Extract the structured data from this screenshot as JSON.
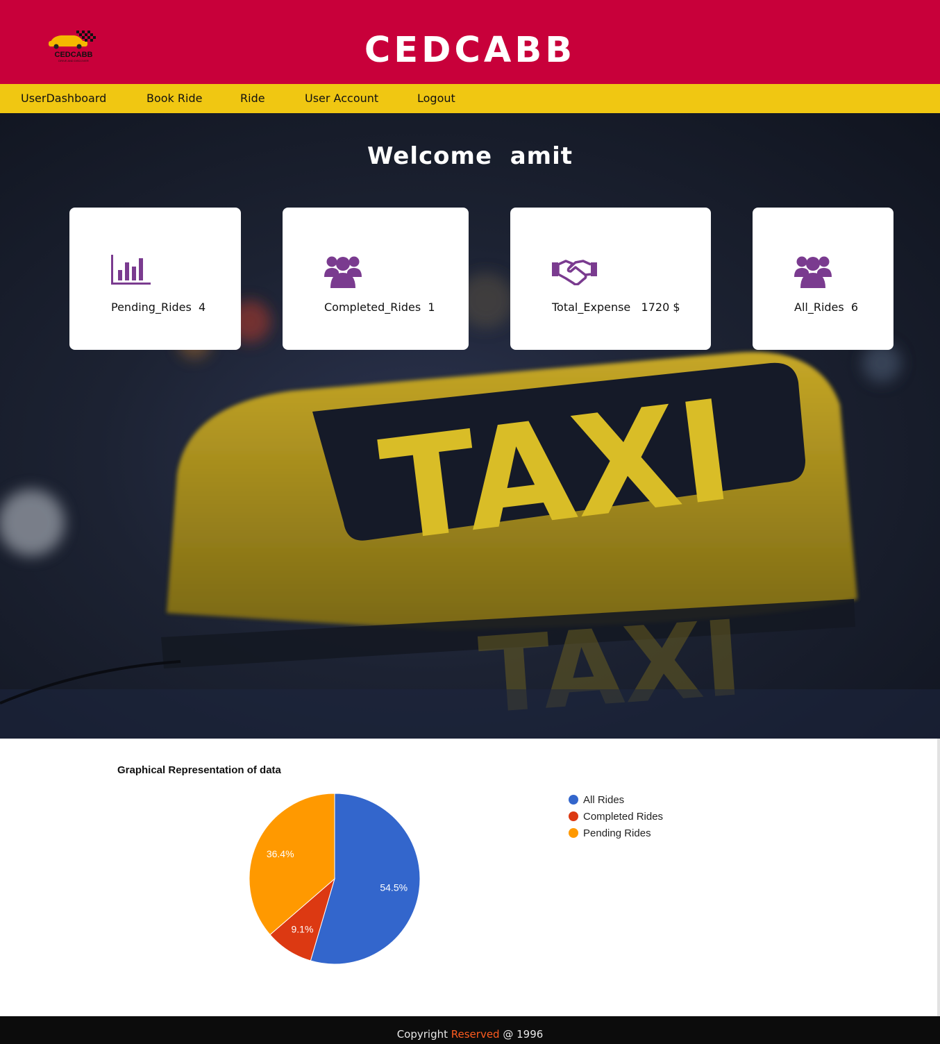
{
  "header": {
    "logo_text": "CEDCABB",
    "logo_tagline": "DRIVE AND DISCOVER",
    "title": "CEDCABB"
  },
  "nav": {
    "items": [
      {
        "label": "UserDashboard"
      },
      {
        "label": "Book Ride"
      },
      {
        "label": "Ride"
      },
      {
        "label": "User Account"
      },
      {
        "label": "Logout"
      }
    ]
  },
  "welcome": {
    "text": "Welcome  amit"
  },
  "stats": [
    {
      "label": "Pending_Rides",
      "value": "4",
      "icon": "bar-chart-icon",
      "display": "Pending_Rides  4"
    },
    {
      "label": "Completed_Rides",
      "value": "1",
      "icon": "users-icon",
      "display": "Completed_Rides  1"
    },
    {
      "label": "Total_Expense",
      "value": "1720 $",
      "icon": "handshake-icon",
      "display": "Total_Expense   1720 $"
    },
    {
      "label": "All_Rides",
      "value": "6",
      "icon": "users-icon",
      "display": "All_Rides  6"
    }
  ],
  "colors": {
    "header": "#c8003a",
    "nav": "#f0c712",
    "icon": "#7a3b8f",
    "footer": "#0c0c0c",
    "footer_accent": "#ff5c1f"
  },
  "chart_data": {
    "type": "pie",
    "title": "Graphical Representation of data",
    "categories": [
      "All Rides",
      "Completed Rides",
      "Pending Rides"
    ],
    "values": [
      6,
      1,
      4
    ],
    "labels": [
      "54.5%",
      "9.1%",
      "36.4%"
    ],
    "colors": [
      "#3366cc",
      "#dc3912",
      "#ff9900"
    ],
    "legend_position": "right"
  },
  "footer": {
    "prefix": "Copyright ",
    "accent": "Reserved",
    "suffix": " @ 1996"
  }
}
